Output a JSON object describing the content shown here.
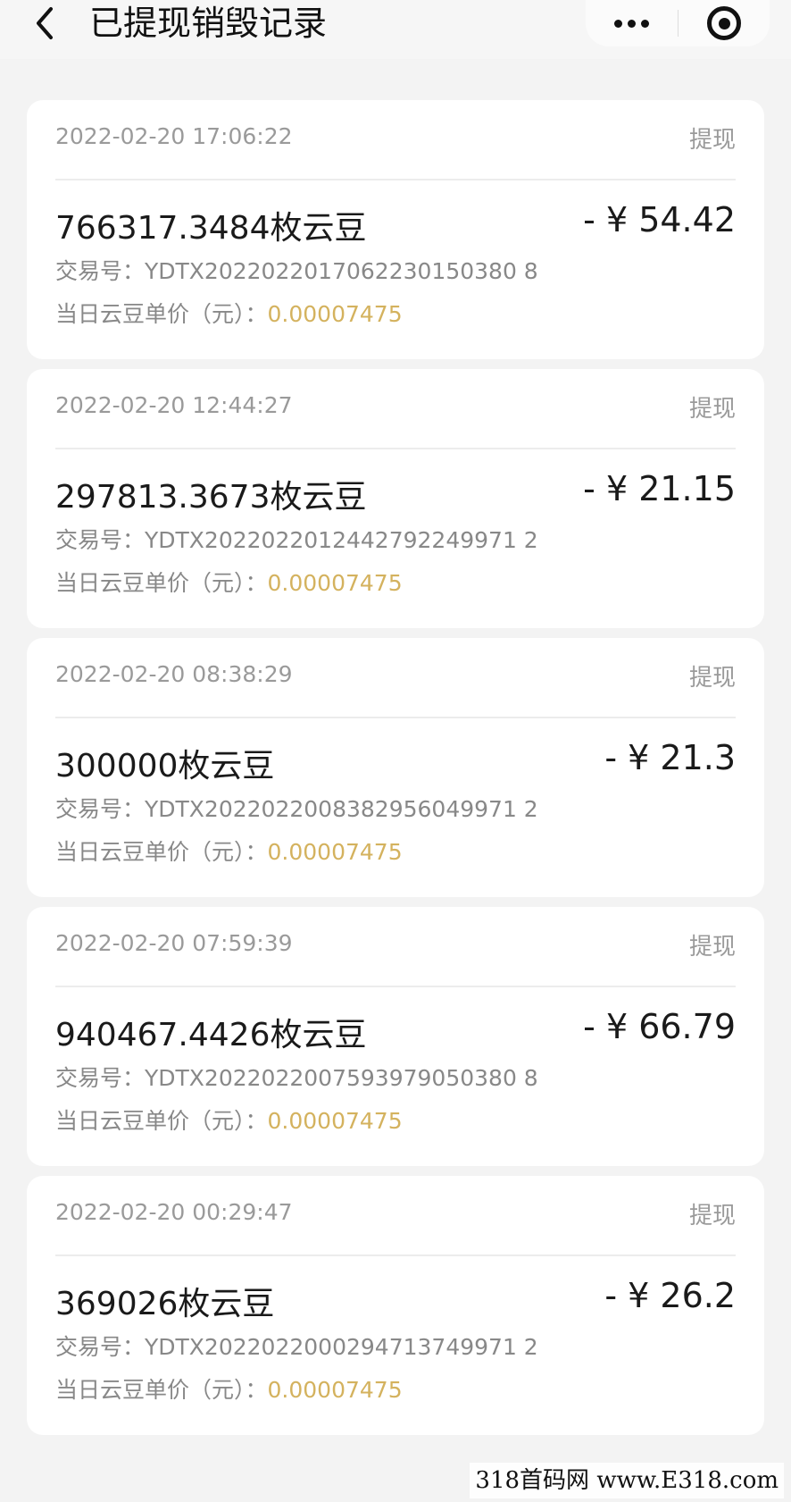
{
  "nav": {
    "title": "已提现销毁记录"
  },
  "records": [
    {
      "time": "2022-02-20 17:06:22",
      "type": "提现",
      "beans": "766317.3484枚云豆",
      "money": "- ¥ 54.42",
      "txn_label": "交易号：",
      "txn_no": "YDTX2022022017062230150380 8",
      "price_label": "当日云豆单价（元）：",
      "price": "0.00007475"
    },
    {
      "time": "2022-02-20 12:44:27",
      "type": "提现",
      "beans": "297813.3673枚云豆",
      "money": "- ¥ 21.15",
      "txn_label": "交易号：",
      "txn_no": "YDTX2022022012442792249971 2",
      "price_label": "当日云豆单价（元）：",
      "price": "0.00007475"
    },
    {
      "time": "2022-02-20 08:38:29",
      "type": "提现",
      "beans": "300000枚云豆",
      "money": "- ¥ 21.3",
      "txn_label": "交易号：",
      "txn_no": "YDTX2022022008382956049971 2",
      "price_label": "当日云豆单价（元）：",
      "price": "0.00007475"
    },
    {
      "time": "2022-02-20 07:59:39",
      "type": "提现",
      "beans": "940467.4426枚云豆",
      "money": "- ¥ 66.79",
      "txn_label": "交易号：",
      "txn_no": "YDTX2022022007593979050380 8",
      "price_label": "当日云豆单价（元）：",
      "price": "0.00007475"
    },
    {
      "time": "2022-02-20 00:29:47",
      "type": "提现",
      "beans": "369026枚云豆",
      "money": "- ¥ 26.2",
      "txn_label": "交易号：",
      "txn_no": "YDTX2022022000294713749971 2",
      "price_label": "当日云豆单价（元）：",
      "price": "0.00007475"
    }
  ],
  "watermark": "318首码网 www.E318.com",
  "colors": {
    "price_value": "#d4b25e",
    "muted_text": "#9a9a9a",
    "page_bg": "#f3f3f3"
  },
  "icons": {
    "back": "chevron-left-icon",
    "more": "more-dots-icon",
    "close": "target-circle-icon"
  }
}
